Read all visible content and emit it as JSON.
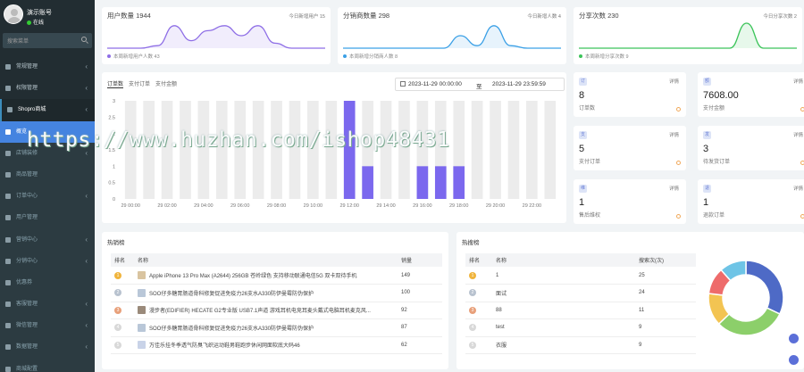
{
  "sidebar": {
    "user_name": "演示账号",
    "user_status": "在线",
    "search_placeholder": "搜索菜单",
    "items": [
      {
        "label": "常规管理",
        "state": "normal",
        "caret": true
      },
      {
        "label": "权限管理",
        "state": "normal",
        "caret": true
      },
      {
        "label": "Shopro商城",
        "state": "open",
        "caret": true
      },
      {
        "label": "概览",
        "state": "active",
        "caret": false
      },
      {
        "label": "店铺装修",
        "state": "sub",
        "caret": true
      },
      {
        "label": "商品管理",
        "state": "sub",
        "caret": false
      },
      {
        "label": "订单中心",
        "state": "sub",
        "caret": true
      },
      {
        "label": "用户管理",
        "state": "sub",
        "caret": false
      },
      {
        "label": "营销中心",
        "state": "sub",
        "caret": true
      },
      {
        "label": "分销中心",
        "state": "sub",
        "caret": true
      },
      {
        "label": "优惠券",
        "state": "sub",
        "caret": false
      },
      {
        "label": "客服管理",
        "state": "sub",
        "caret": true
      },
      {
        "label": "微信管理",
        "state": "sub",
        "caret": true
      },
      {
        "label": "数据管理",
        "state": "sub",
        "caret": true
      },
      {
        "label": "商城配置",
        "state": "sub",
        "caret": false
      }
    ]
  },
  "stats": [
    {
      "title": "用户数量 1944",
      "right": "今日新增用户 15",
      "footer": "本周新增用户人数 43",
      "color": "#8e6ee6",
      "spark": [
        0,
        0,
        0,
        0.1,
        0.9,
        0.3,
        0.7,
        0.9,
        0.5,
        0.9,
        0.2,
        0,
        0,
        0
      ]
    },
    {
      "title": "分销商数量 298",
      "right": "今日新增人数 4",
      "footer": "本周新增分销商人数 8",
      "color": "#3ba0e6",
      "spark": [
        0,
        0,
        0,
        0,
        0,
        0,
        0,
        0.5,
        0.1,
        0.9,
        0.1,
        0,
        0,
        0
      ]
    },
    {
      "title": "分享次数 230",
      "right": "今日分享次数 2",
      "footer": "本周新增分享次数 9",
      "color": "#3cc45a",
      "spark": [
        0,
        0,
        0,
        0,
        0,
        0,
        0,
        0,
        0,
        0,
        1,
        0,
        0,
        0
      ]
    }
  ],
  "orders": {
    "tabs": [
      "订单数",
      "支付订单",
      "支付金额"
    ],
    "date_start": "2023-11-29 00:00:00",
    "date_to": "至",
    "date_end": "2023-11-29 23:59:59"
  },
  "chart_data": {
    "type": "bar",
    "categories": [
      "29 00:00",
      "29 01:00",
      "29 02:00",
      "29 03:00",
      "29 04:00",
      "29 05:00",
      "29 06:00",
      "29 07:00",
      "29 08:00",
      "29 09:00",
      "29 10:00",
      "29 11:00",
      "29 12:00",
      "29 13:00",
      "29 14:00",
      "29 15:00",
      "29 16:00",
      "29 17:00",
      "29 18:00",
      "29 19:00",
      "29 20:00",
      "29 21:00",
      "29 22:00",
      "29 23:00"
    ],
    "tick_labels": [
      "29 00:00",
      "29 02:00",
      "29 04:00",
      "29 06:00",
      "29 08:00",
      "29 10:00",
      "29 12:00",
      "29 14:00",
      "29 16:00",
      "29 18:00",
      "29 20:00",
      "29 22:00"
    ],
    "values": [
      0,
      0,
      0,
      0,
      0,
      0,
      0,
      0,
      0,
      0,
      0,
      0,
      3,
      1,
      0,
      0,
      1,
      1,
      1,
      0,
      0,
      0,
      0,
      0
    ],
    "ylim": [
      0,
      3
    ],
    "yticks": [
      "0",
      "0.5",
      "1",
      "1.5",
      "2",
      "2.5",
      "3"
    ],
    "bar_color": "#7b68ee",
    "background_bar_color": "#ececec"
  },
  "summary_cards": [
    {
      "icon": "订",
      "value": "8",
      "label": "订单数",
      "link": "详情"
    },
    {
      "icon": "额",
      "value": "7608.00",
      "label": "支付金额",
      "link": "详情"
    },
    {
      "icon": "支",
      "value": "5",
      "label": "支付订单",
      "link": "详情"
    },
    {
      "icon": "发",
      "value": "3",
      "label": "待发货订单",
      "link": "详情"
    },
    {
      "icon": "维",
      "value": "1",
      "label": "售后维权",
      "link": "详情"
    },
    {
      "icon": "退",
      "value": "1",
      "label": "退款订单",
      "link": "详情"
    }
  ],
  "hot_goods": {
    "title": "热销榜",
    "headers": [
      "排名",
      "名称",
      "销量"
    ],
    "rows": [
      {
        "rank": "1",
        "name": "Apple iPhone 13 Pro Max (A2644) 256GB 苍岭绿色 支持移动联通电信5G 双卡双待手机",
        "sales": "149",
        "rc": "#f0b43c",
        "tc": "#d9c4a0"
      },
      {
        "rank": "2",
        "name": "SOO仔多糖胃肠道骨科修复促进免疫力26支水A330防伊曼霉防伪保护",
        "sales": "100",
        "rc": "#b8c2cf",
        "tc": "#b9c7d8"
      },
      {
        "rank": "3",
        "name": "漫步者(EDIFIER) HECATE G2专业版 USB7.1声道 游戏耳机电竞耳麦头戴式电脑耳机麦克风...",
        "sales": "92",
        "rc": "#e8a07a",
        "tc": "#9a8a7a"
      },
      {
        "rank": "4",
        "name": "SOO仔多糖胃肠道骨科修复促进免疫力26支水A330防伊曼霉防伪保护",
        "sales": "87",
        "rc": "#d8d8d8",
        "tc": "#b9c7d8"
      },
      {
        "rank": "5",
        "name": "万佳乐挂冬季透气防臭飞织运动鞋男鞋跑步休闲网面软底大码46",
        "sales": "62",
        "rc": "#d8d8d8",
        "tc": "#c9d3e8"
      }
    ]
  },
  "hot_search": {
    "title": "热搜榜",
    "headers": [
      "排名",
      "名称",
      "搜索次(次)"
    ],
    "rows": [
      {
        "rank": "1",
        "name": "1",
        "count": "25",
        "rc": "#f0b43c"
      },
      {
        "rank": "2",
        "name": "面试",
        "count": "24",
        "rc": "#b8c2cf"
      },
      {
        "rank": "3",
        "name": "88",
        "count": "11",
        "rc": "#e8a07a"
      },
      {
        "rank": "4",
        "name": "test",
        "count": "9",
        "rc": "#d8d8d8"
      },
      {
        "rank": "5",
        "name": "衣服",
        "count": "9",
        "rc": "#d8d8d8"
      }
    ],
    "donut": [
      25,
      24,
      11,
      9,
      9
    ],
    "donut_colors": [
      "#4e6ac6",
      "#8ccf6a",
      "#f3c452",
      "#ee6b6b",
      "#6ec4e6"
    ]
  },
  "watermark": "https://www.huzhan.com/ishop48431"
}
